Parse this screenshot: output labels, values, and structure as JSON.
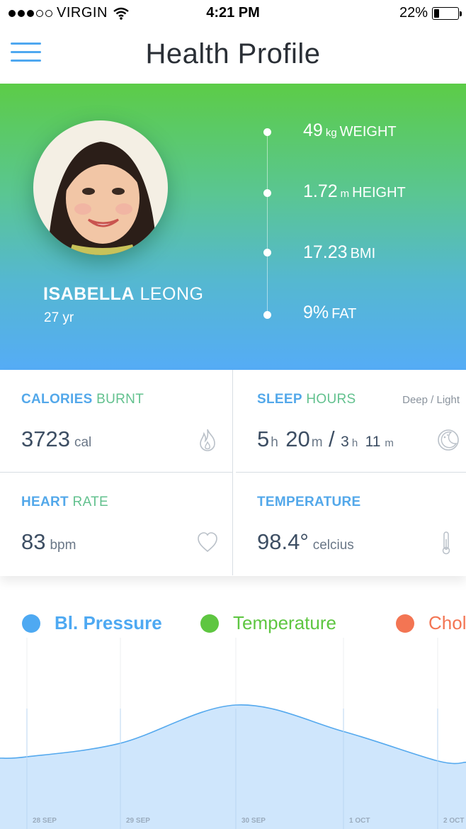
{
  "status_bar": {
    "carrier": "VIRGIN",
    "time": "4:21 PM",
    "battery": "22%",
    "battery_level": 0.22,
    "signal_bars": 3
  },
  "nav": {
    "title": "Health Profile",
    "menu_icon": "hamburger-menu-icon"
  },
  "profile": {
    "first_name": "ISABELLA",
    "last_name": "LEONG",
    "age": "27 yr",
    "stats": [
      {
        "value": "49",
        "unit": "kg",
        "label": "WEIGHT"
      },
      {
        "value": "1.72",
        "unit": "m",
        "label": "HEIGHT"
      },
      {
        "value": "17.23",
        "unit": "",
        "label": "BMI"
      },
      {
        "value": "9%",
        "unit": "",
        "label": "FAT"
      }
    ]
  },
  "metrics": {
    "calories": {
      "title_a": "CALORIES",
      "title_b": "BURNT",
      "value": "3723",
      "unit": "cal",
      "icon": "flame-icon"
    },
    "sleep": {
      "title_a": "SLEEP",
      "title_b": "HOURS",
      "note": "Deep / Light",
      "deep_h": "5",
      "deep_h_unit": "h",
      "deep_m": "20",
      "deep_m_unit": "m",
      "sep": "/",
      "light_h": "3",
      "light_h_unit": "h",
      "light_m": "11",
      "light_m_unit": "m",
      "icon": "moon-icon"
    },
    "heart": {
      "title_a": "HEART",
      "title_b": "RATE",
      "value": "83",
      "unit": "bpm",
      "icon": "heart-icon"
    },
    "temperature": {
      "title_a": "TEMPERATURE",
      "value": "98.4°",
      "unit": "celcius",
      "icon": "thermometer-icon"
    }
  },
  "chart_data": {
    "type": "area",
    "legend": [
      {
        "name": "Bl. Pressure",
        "color": "#4ea9f2",
        "active": true
      },
      {
        "name": "Temperature",
        "color": "#5ec641",
        "active": false
      },
      {
        "name": "Chol",
        "color": "#f37553",
        "active": false
      }
    ],
    "x": [
      "28 SEP",
      "29 SEP",
      "30 SEP",
      "1 OCT",
      "2 OCT"
    ],
    "series": [
      {
        "name": "Bl. Pressure",
        "values": [
          0.12,
          0.35,
          1.0,
          0.55,
          0.05
        ]
      }
    ],
    "fill_color": "#cfe6fc",
    "line_color": "#55a9ee",
    "grid": true
  }
}
